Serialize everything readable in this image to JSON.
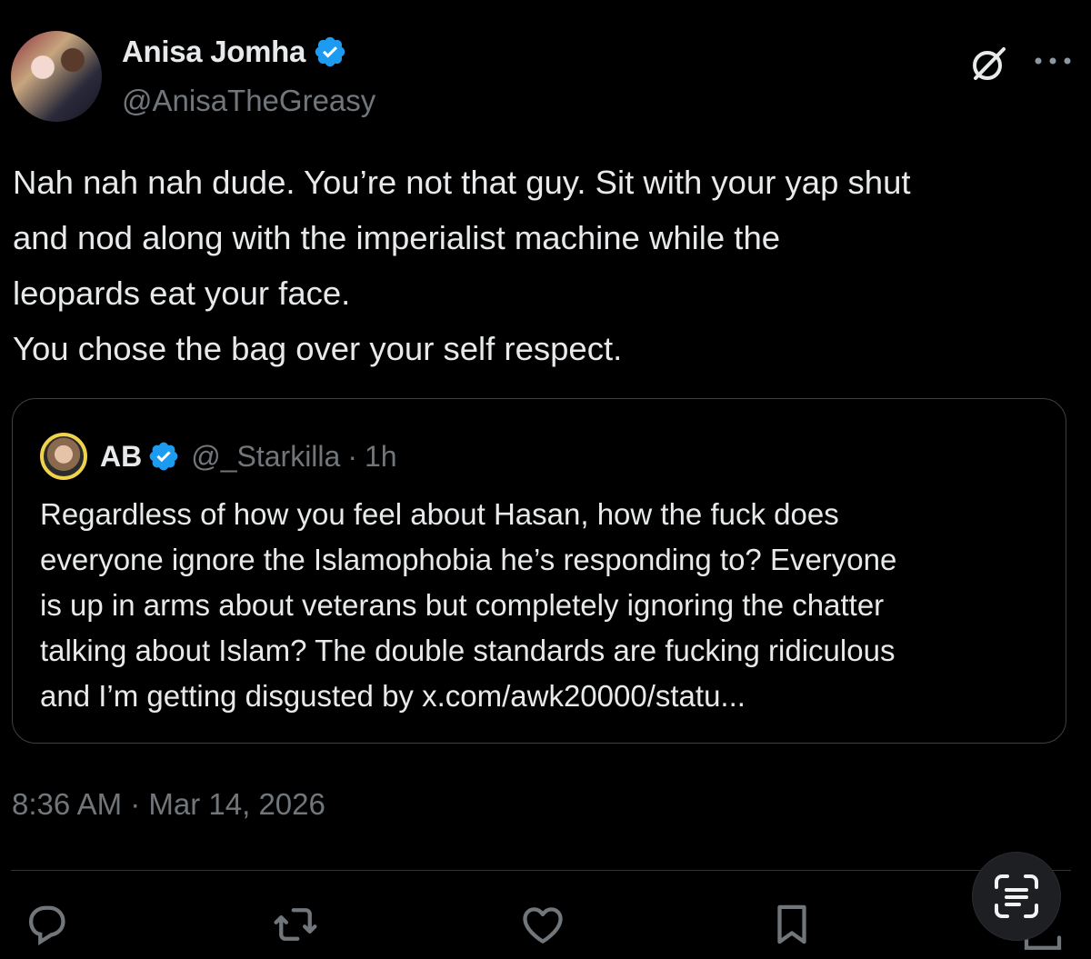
{
  "author": {
    "display_name": "Anisa Jomha",
    "handle": "@AnisaTheGreasy",
    "verified": true
  },
  "tweet": {
    "lines": [
      "Nah nah nah dude. You’re not that guy. Sit with your yap shut",
      "and nod along with the imperialist machine while the",
      "leopards eat your face.",
      "You chose the bag over your self respect."
    ],
    "timestamp": "8:36 AM · Mar 14, 2026"
  },
  "quoted_tweet": {
    "display_name": "AB",
    "handle": "@_Starkilla",
    "separator": "·",
    "time": "1h",
    "verified": true,
    "lines": [
      "Regardless of how you feel about Hasan, how the fuck does",
      "everyone ignore the Islamophobia he’s responding to? Everyone",
      "is up in arms about veterans but completely ignoring the chatter",
      "talking about Islam? The double standards are fucking ridiculous",
      "and I’m getting disgusted by x.com/awk20000/statu..."
    ]
  },
  "actions": {
    "icons": [
      "reply-icon",
      "repost-icon",
      "like-icon",
      "bookmark-icon",
      "share-icon"
    ]
  },
  "colors": {
    "background": "#000000",
    "text": "#e7e9ea",
    "secondary": "#71767b",
    "verified": "#1d9bf0",
    "border": "#3e4144"
  }
}
